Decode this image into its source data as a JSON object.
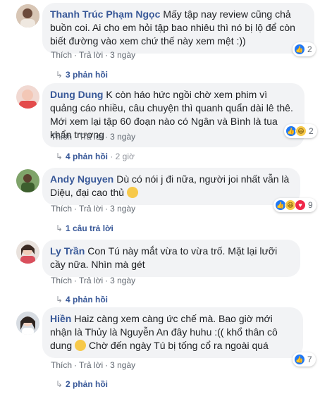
{
  "comments": [
    {
      "author": "Thanh Trúc Phạm Ngọc",
      "text": "Mấy tập nay review cũng chả buồn coi. Ai cho em hỏi tập bao nhiêu thì nó bị lộ để còn biết đường vào xem chứ thế này xem mệt :))",
      "like_label": "Thích",
      "reply_label": "Trả lời",
      "time": "3 ngày",
      "reaction_count": "2",
      "reactions": [
        "like-icon"
      ],
      "replies_label": "3 phản hồi",
      "replies_time": ""
    },
    {
      "author": "Dung Dung",
      "text": "K còn háo hức ngồi chờ xem phim vì quảng cáo nhiều, câu chuyện thì quanh quẩn dài lê thê. Mới xem lại tập 60 đoạn nào có Ngân và Bình là tua khẩn trương",
      "like_label": "Thích",
      "reply_label": "Trả lời",
      "time": "3 ngày",
      "reaction_count": "2",
      "reactions": [
        "like-icon",
        "haha-icon"
      ],
      "replies_label": "4 phản hồi",
      "replies_time": "2 giờ"
    },
    {
      "author": "Andy Nguyen",
      "text": "Dù có nói j đi nữa, người joi nhất vẫn là Diệu, đại cao thủ",
      "like_label": "Thích",
      "reply_label": "Trả lời",
      "time": "3 ngày",
      "reaction_count": "9",
      "reactions": [
        "like-icon",
        "haha-icon",
        "love-icon"
      ],
      "replies_label": "1 câu trả lời",
      "replies_time": ""
    },
    {
      "author": "Ly Trần",
      "text": "Con Tú này mắt vừa to vừa trố. Mặt lại lưỡi cầy nữa. Nhìn mà gét",
      "like_label": "Thích",
      "reply_label": "Trả lời",
      "time": "3 ngày",
      "reaction_count": "",
      "reactions": [],
      "replies_label": "4 phản hồi",
      "replies_time": ""
    },
    {
      "author": "Hiền",
      "text": "Haiz càng xem càng ức chế mà. Bao giờ mới nhận là Thủy là Nguyễn An đây huhu :(( khổ thân cô dung",
      "text_after_emoji": "Chờ đến ngày Tú bị tống cổ ra ngoài quá",
      "like_label": "Thích",
      "reply_label": "Trả lời",
      "time": "3 ngày",
      "reaction_count": "7",
      "reactions": [
        "like-icon"
      ],
      "replies_label": "2 phản hồi",
      "replies_time": ""
    }
  ],
  "colors": {
    "author": "#385898",
    "bubble": "#f2f3f5",
    "meta": "#606770",
    "like": "#2078f4"
  }
}
